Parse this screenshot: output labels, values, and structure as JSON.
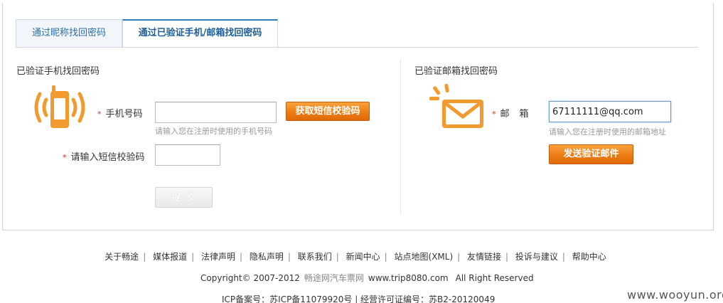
{
  "tabs": [
    {
      "label": "通过昵称找回密码"
    },
    {
      "label": "通过已验证手机/邮箱找回密码"
    }
  ],
  "phone_section": {
    "title": "已验证手机找回密码",
    "phone_label": "手机号码",
    "phone_value": "",
    "phone_hint": "请输入您在注册时使用的手机号码",
    "sms_button": "获取短信校验码",
    "sms_label": "请输入短信校验码",
    "sms_value": "",
    "submit_label": "提交"
  },
  "email_section": {
    "title": "已验证邮箱找回密码",
    "email_label": "邮箱",
    "email_value": "67111111@qq.com",
    "email_hint": "请输入您在注册时使用的邮箱地址",
    "send_button": "发送验证邮件"
  },
  "required_mark": "*",
  "footer": {
    "links": [
      "关于畅途",
      "媒体报道",
      "法律声明",
      "隐私声明",
      "联系我们",
      "新闻中心",
      "站点地图(XML)",
      "友情链接",
      "投诉与建议",
      "帮助中心"
    ],
    "separator": "|",
    "copyright": "Copyright© 2007-2012",
    "brand": "畅途网汽车票网",
    "site": "www.trip8080.com",
    "rights": "All Right Reserved",
    "icp": "ICP备案号：苏ICP备11079920号 | 经营许可证编号：苏B2-20120049"
  },
  "watermark": "www.wooyun.org",
  "colors": {
    "accent_orange": "#ec7b14",
    "tab_blue": "#2b7bc0",
    "required_red": "#d0312d"
  },
  "icons": {
    "phone": "phone-signal-icon",
    "mail": "envelope-icon"
  }
}
